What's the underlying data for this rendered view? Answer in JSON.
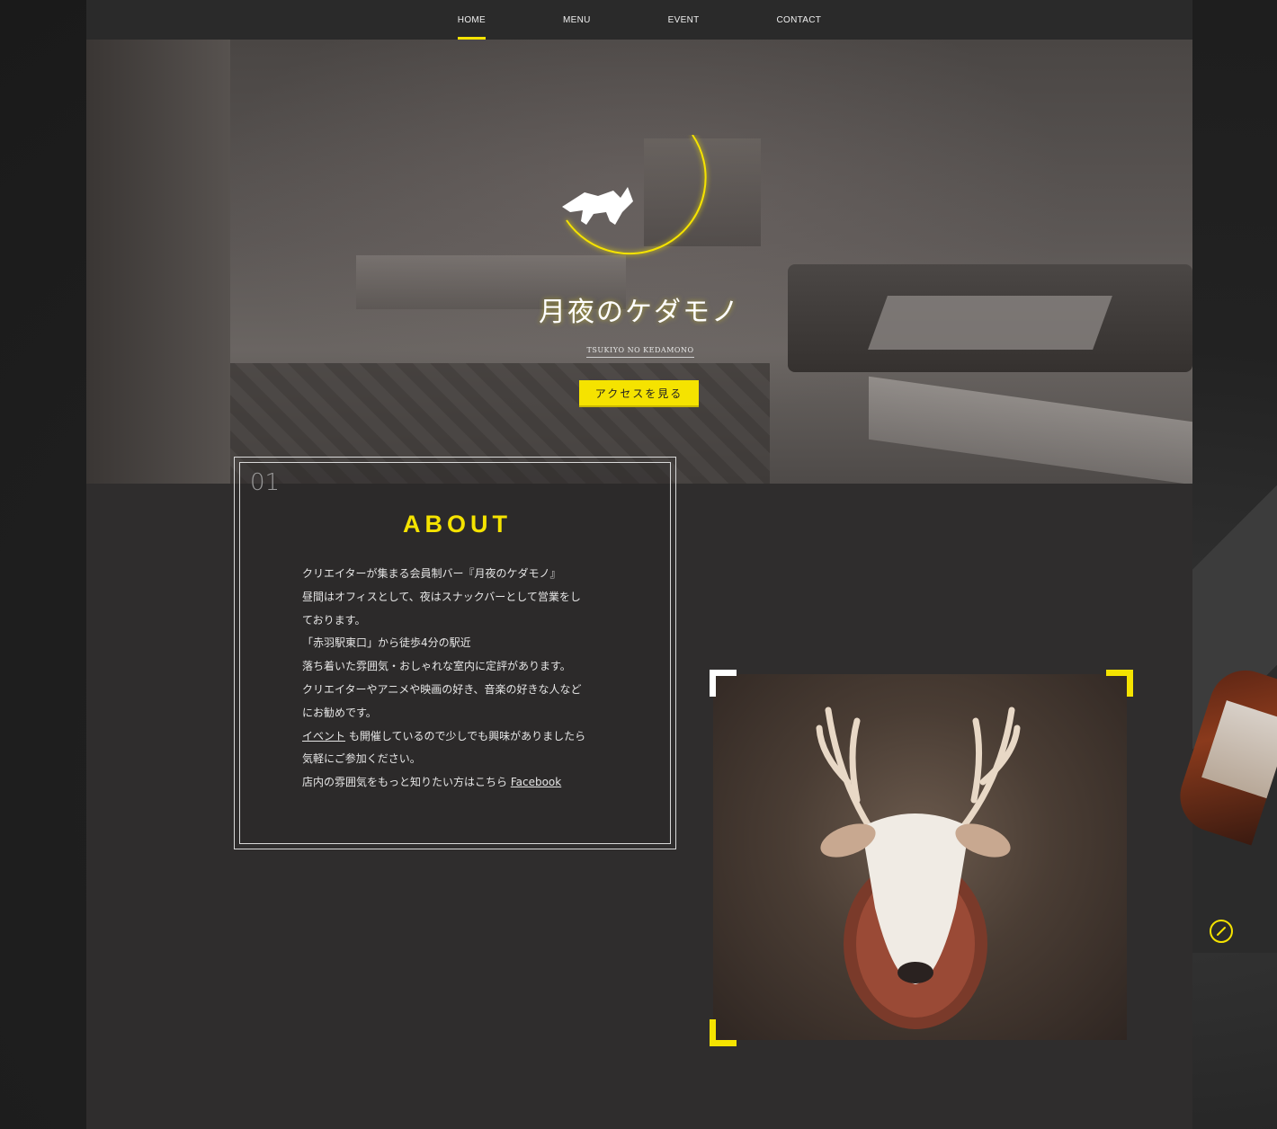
{
  "nav": {
    "items": [
      {
        "label": "HOME",
        "active": true
      },
      {
        "label": "MENU",
        "active": false
      },
      {
        "label": "EVENT",
        "active": false
      },
      {
        "label": "CONTACT",
        "active": false
      }
    ]
  },
  "hero": {
    "title": "月夜のケダモノ",
    "subtitle": "TSUKIYO NO KEDAMONO",
    "access_button": "アクセスを見る"
  },
  "about": {
    "number": "01",
    "title": "ABOUT",
    "lines": [
      "クリエイターが集まる会員制バー『月夜のケダモノ』",
      "昼間はオフィスとして、夜はスナックバーとして営業をし",
      "ております。",
      "「赤羽駅東口」から徒歩4分の駅近",
      "落ち着いた雰囲気・おしゃれな室内に定評があります。",
      "クリエイターやアニメや映画の好き、音楽の好きな人など",
      "にお勧めです。"
    ],
    "event_link": "イベント",
    "event_line_rest": " も開催しているので少しでも興味がありましたら",
    "line_after_event": "気軽にご参加ください。",
    "facebook_prefix": "店内の雰囲気をもっと知りたい方はこちら ",
    "facebook_link": "Facebook"
  },
  "colors": {
    "accent": "#f5e300",
    "page_bg": "#2f2d2d",
    "nav_bg": "#2a2a2a"
  },
  "icons": {
    "compass": "compass-icon",
    "logo": "crescent-moon-wolf-logo"
  }
}
